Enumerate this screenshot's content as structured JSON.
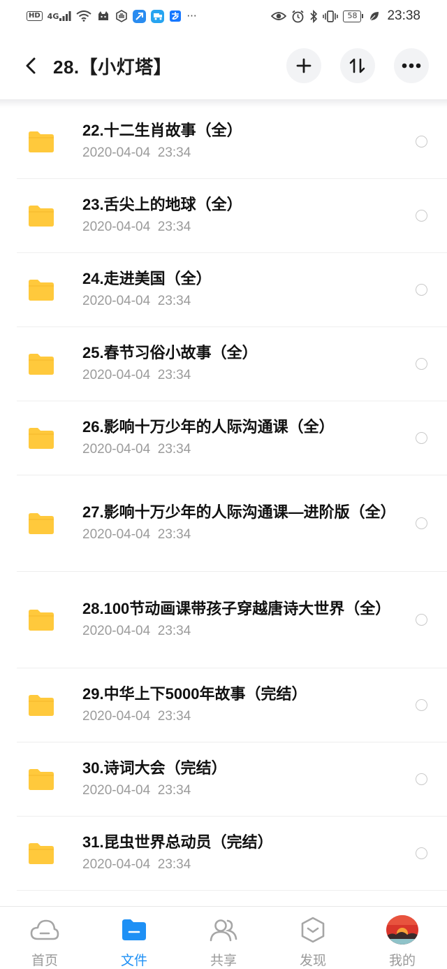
{
  "status_bar": {
    "hd": "HD",
    "signal": "4G",
    "battery": "58",
    "time": "23:38",
    "more": "···"
  },
  "header": {
    "title": "28.【小灯塔】"
  },
  "files": [
    {
      "name": "22.十二生肖故事（全）",
      "date": "2020-04-04  23:34"
    },
    {
      "name": "23.舌尖上的地球（全）",
      "date": "2020-04-04  23:34"
    },
    {
      "name": "24.走进美国（全）",
      "date": "2020-04-04  23:34"
    },
    {
      "name": "25.春节习俗小故事（全）",
      "date": "2020-04-04  23:34"
    },
    {
      "name": "26.影响十万少年的人际沟通课（全）",
      "date": "2020-04-04  23:34"
    },
    {
      "name": "27.影响十万少年的人际沟通课—进阶版（全）",
      "date": "2020-04-04  23:34"
    },
    {
      "name": "28.100节动画课带孩子穿越唐诗大世界（全）",
      "date": "2020-04-04  23:34"
    },
    {
      "name": "29.中华上下5000年故事（完结）",
      "date": "2020-04-04  23:34"
    },
    {
      "name": "30.诗词大会（完结）",
      "date": "2020-04-04  23:34"
    },
    {
      "name": "31.昆虫世界总动员（完结）",
      "date": "2020-04-04  23:34"
    }
  ],
  "nav": {
    "home": "首页",
    "files": "文件",
    "share": "共享",
    "discover": "发现",
    "mine": "我的"
  },
  "colors": {
    "accent": "#1e90f5",
    "folder": "#ffc93c"
  }
}
